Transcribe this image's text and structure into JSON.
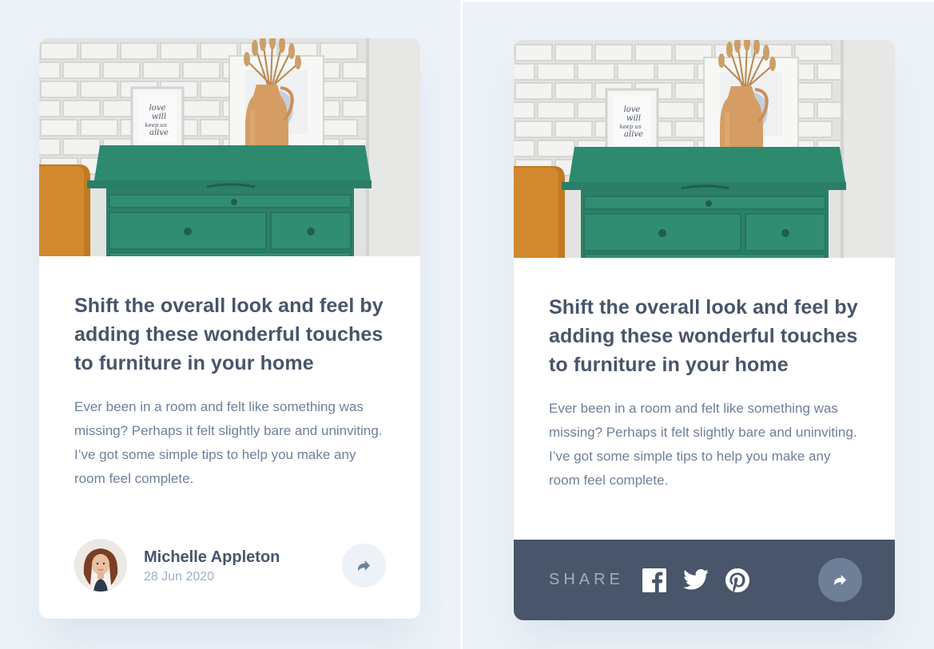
{
  "card": {
    "title": "Shift the overall look and feel by adding these wonderful touches to furniture in your home",
    "description": "Ever been in a room and felt like something was missing? Perhaps it felt slightly bare and uninviting. I’ve got some simple tips to help you make any room feel complete.",
    "author": {
      "name": "Michelle Appleton",
      "date": "28 Jun 2020"
    },
    "frame_text": [
      "love",
      "will",
      "keep us",
      "alive"
    ]
  },
  "share": {
    "label": "SHARE",
    "networks": [
      {
        "icon": "facebook-icon"
      },
      {
        "icon": "twitter-icon"
      },
      {
        "icon": "pinterest-icon"
      }
    ],
    "share_icon": "share-arrow-icon"
  },
  "colors": {
    "background": "#ecf2f8",
    "title": "#48556a",
    "text": "#6e8098",
    "muted": "#9eafc2",
    "share_bar": "#48556a",
    "dresser": "#2e8a6f"
  }
}
